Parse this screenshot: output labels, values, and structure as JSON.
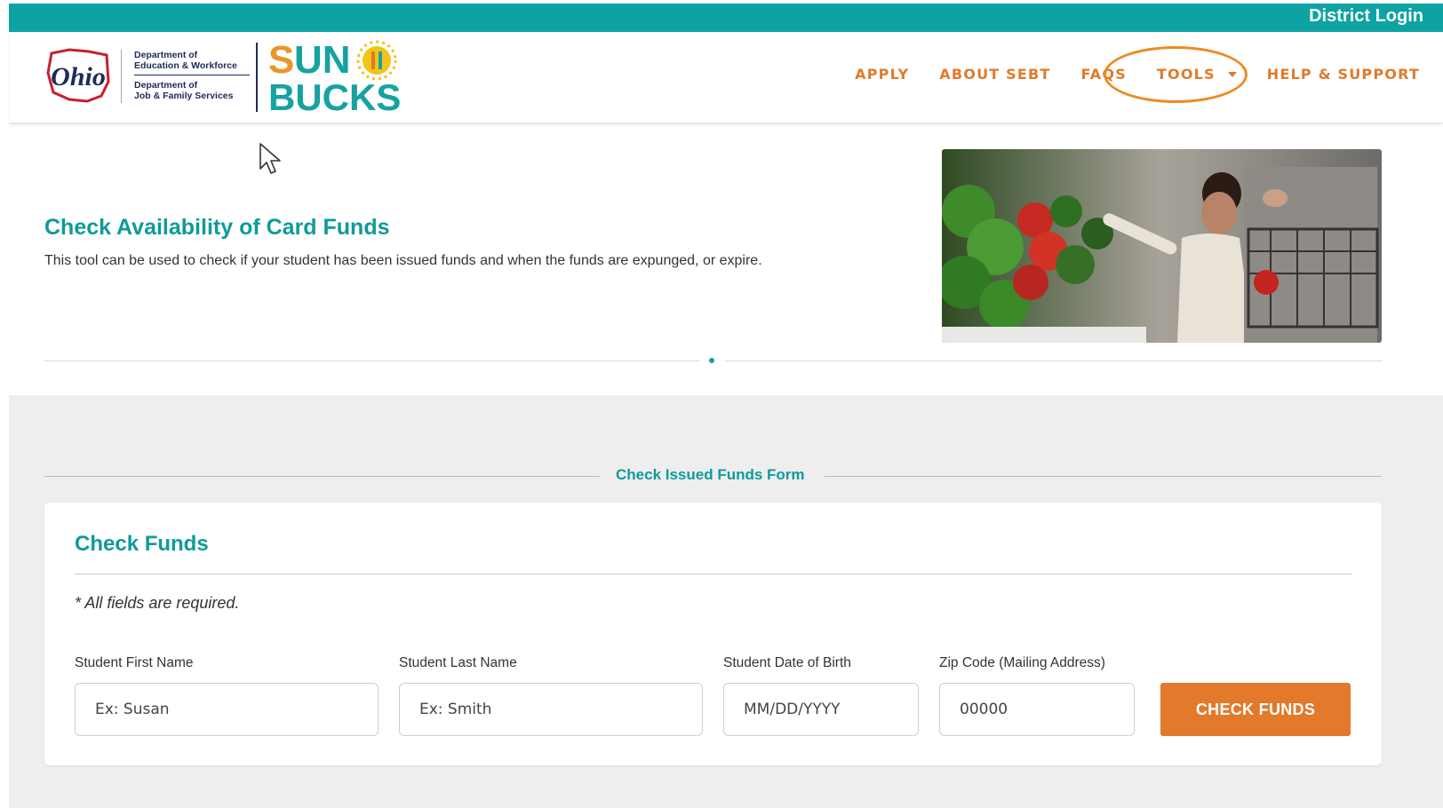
{
  "topbar": {
    "district_login": "District Login"
  },
  "header": {
    "dept_line1": "Department of\nEducation & Workforce",
    "dept_line2": "Department of\nJob & Family Services",
    "nav": {
      "apply": "APPLY",
      "about": "ABOUT SEBT",
      "faqs": "FAQS",
      "tools": "TOOLS",
      "help": "HELP & SUPPORT"
    }
  },
  "hero": {
    "title": "Check Availability of Card Funds",
    "description": "This tool can be used to check if your student has been issued funds and when the funds are expunged, or expire."
  },
  "form_section": {
    "caption": "Check Issued Funds Form",
    "card_title": "Check Funds",
    "required_note": "* All fields are required.",
    "fields": {
      "first_name": {
        "label": "Student First Name",
        "placeholder": "Ex: Susan"
      },
      "last_name": {
        "label": "Student Last Name",
        "placeholder": "Ex: Smith"
      },
      "dob": {
        "label": "Student Date of Birth",
        "placeholder": "MM/DD/YYYY"
      },
      "zip": {
        "label": "Zip Code (Mailing Address)",
        "placeholder": "00000"
      }
    },
    "submit_label": "CHECK FUNDS"
  },
  "colors": {
    "teal": "#0ea3a3",
    "orange": "#e2792b",
    "navy": "#1e2a5a",
    "highlight_ring": "#ee8a1f"
  }
}
